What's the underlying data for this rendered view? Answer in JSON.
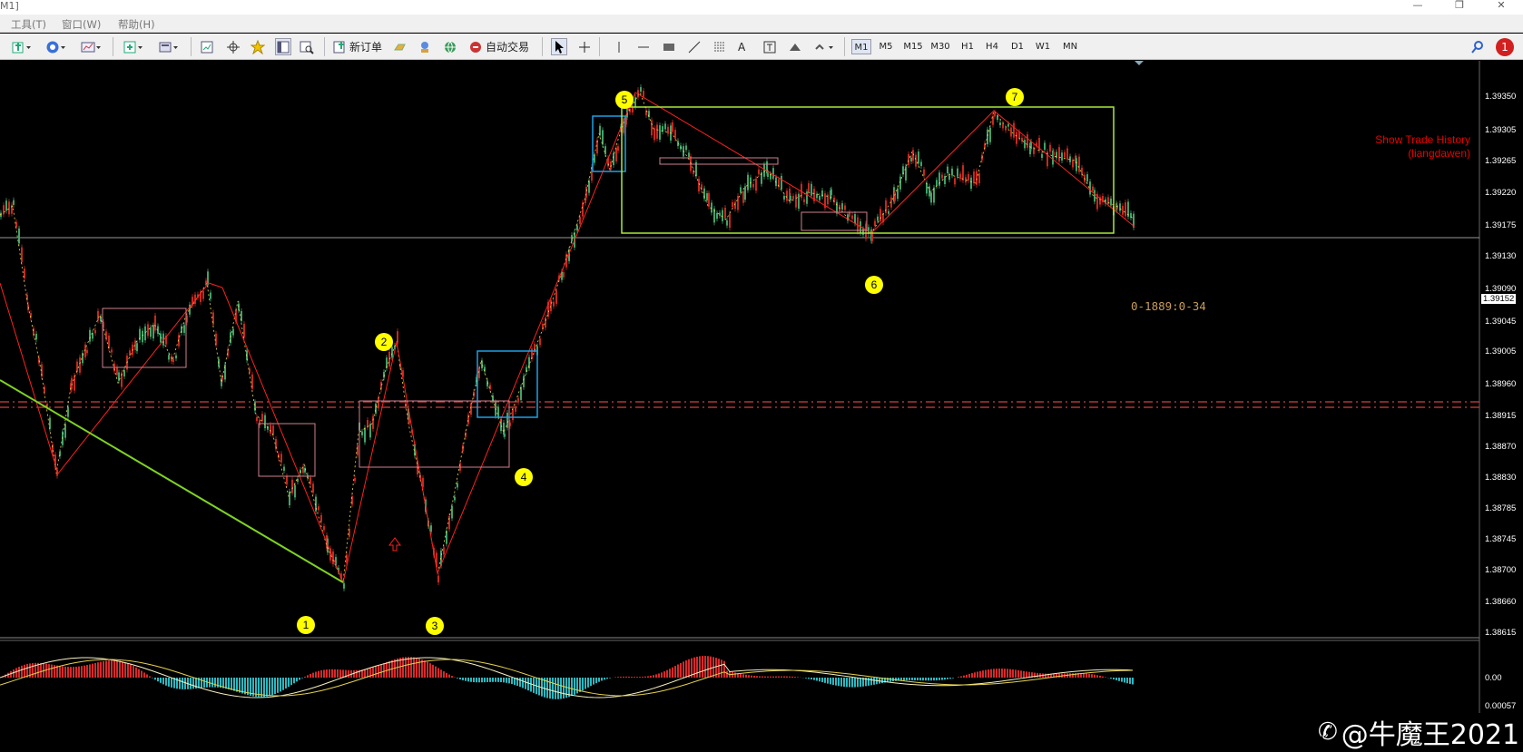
{
  "window": {
    "title": "M1]",
    "controls": [
      "—",
      "❐",
      "✕"
    ],
    "mdi_controls": [
      "_",
      "❐",
      "✕"
    ]
  },
  "menu": [
    "工具(T)",
    "窗口(W)",
    "帮助(H)"
  ],
  "toolbar": {
    "new_order": "新订单",
    "auto_trading": "自动交易",
    "text_tool": "A",
    "timeframes": [
      "M1",
      "M5",
      "M15",
      "M30",
      "H1",
      "H4",
      "D1",
      "W1",
      "MN"
    ],
    "active_timeframe": "M1",
    "alert_count": "1"
  },
  "chart": {
    "price_axis": [
      "1.39350",
      "1.39305",
      "1.39265",
      "1.39220",
      "1.39175",
      "1.39152",
      "1.39130",
      "1.39090",
      "1.39045",
      "1.39005",
      "1.38960",
      "1.38915",
      "1.38870",
      "1.38830",
      "1.38785",
      "1.38745",
      "1.38700",
      "1.38660",
      "1.38615"
    ],
    "current_price": "1.39152",
    "trade_history_label": [
      "Show Trade History",
      "(liangdawen)"
    ],
    "line_label": "0-1889:0-34",
    "wave_markers": [
      "1",
      "2",
      "3",
      "4",
      "5",
      "6",
      "7"
    ],
    "oscillator_level": "0.00057",
    "oscillator_zero": "0.00",
    "colors": {
      "background": "#000000",
      "up_candle": "#3fa36a",
      "down_candle": "#c8281e",
      "zigzag": "#ff2020",
      "trend_line": "#7fd321",
      "range_box": "#a8e83a",
      "consolidation_box": "#d08090",
      "breakout_box": "#1ea0e6",
      "marker": "#ffff00",
      "resistance": "#d04040"
    }
  },
  "watermark": "@牛魔王2021"
}
